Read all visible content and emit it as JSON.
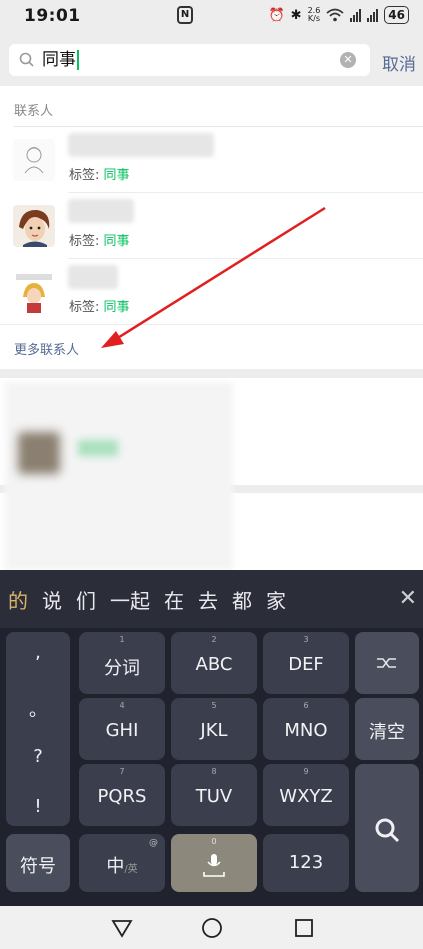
{
  "status": {
    "time": "19:01",
    "nfc": "N",
    "net_speed_value": "2.6",
    "net_speed_unit": "K/s",
    "battery": "46"
  },
  "search": {
    "value": "同事",
    "cancel_label": "取消"
  },
  "contacts": {
    "section_title": "联系人",
    "items": [
      {
        "tag_label": "标签:",
        "tag_value": "同事"
      },
      {
        "tag_label": "标签:",
        "tag_value": "同事"
      },
      {
        "tag_label": "标签:",
        "tag_value": "同事"
      }
    ],
    "more_label": "更多联系人"
  },
  "ime": {
    "candidates": [
      "的",
      "说",
      "们",
      "一起",
      "在",
      "去",
      "都",
      "家"
    ],
    "punctuation": [
      ",",
      "。",
      "?",
      "!"
    ],
    "keys": [
      {
        "num": "1",
        "label": "分词"
      },
      {
        "num": "2",
        "label": "ABC"
      },
      {
        "num": "3",
        "label": "DEF"
      },
      {
        "num": "4",
        "label": "GHI"
      },
      {
        "num": "5",
        "label": "JKL"
      },
      {
        "num": "6",
        "label": "MNO"
      },
      {
        "num": "7",
        "label": "PQRS"
      },
      {
        "num": "8",
        "label": "TUV"
      },
      {
        "num": "9",
        "label": "WXYZ"
      }
    ],
    "clear_label": "清空",
    "symbol_label": "符号",
    "lang_label": "中",
    "lang_sub": "/英",
    "space_num": "0",
    "num_label": "123",
    "lang_at": "@"
  },
  "colors": {
    "accent_green": "#07c160",
    "link_blue": "#576b95",
    "annotation_red": "#e02020"
  }
}
